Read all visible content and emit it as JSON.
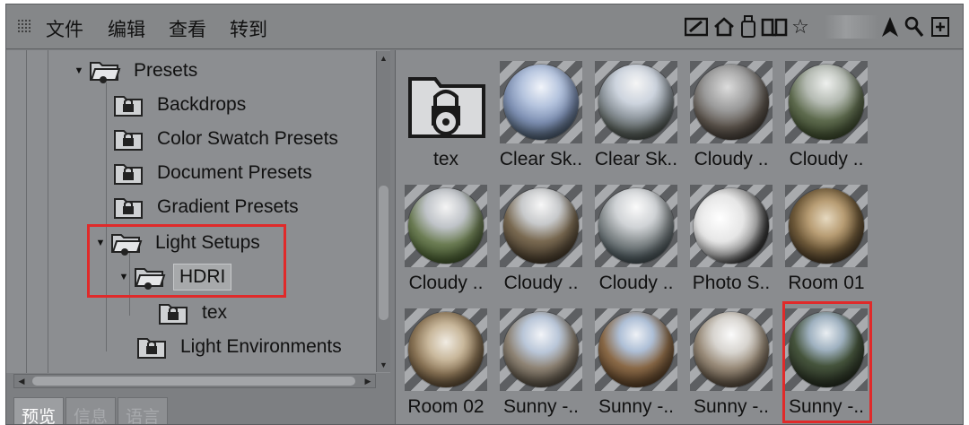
{
  "menu": {
    "items": [
      "文件",
      "编辑",
      "查看",
      "转到"
    ]
  },
  "toolbar_icons": [
    "edit-icon",
    "home-icon",
    "cylinder-icon",
    "book-icon",
    "star-icon",
    "pointer-icon",
    "search-icon",
    "add-icon"
  ],
  "tree": {
    "presets": "Presets",
    "backdrops": "Backdrops",
    "color_swatch": "Color Swatch Presets",
    "document": "Document Presets",
    "gradient": "Gradient Presets",
    "light_setups": "Light Setups",
    "hdri": "HDRI",
    "tex": "tex",
    "light_environments": "Light Environments"
  },
  "tabs": [
    "预览",
    "信息",
    "语言"
  ],
  "grid": {
    "items": [
      "tex",
      "Clear Sk..",
      "Clear Sk..",
      "Cloudy ..",
      "Cloudy ..",
      "Cloudy ..",
      "Cloudy ..",
      "Cloudy ..",
      "Photo S..",
      "Room 01",
      "Room 02",
      "Sunny -..",
      "Sunny -..",
      "Sunny -..",
      "Sunny -.."
    ]
  },
  "colors": {
    "highlight": "#e02a2a",
    "background": "#7d7f82"
  }
}
